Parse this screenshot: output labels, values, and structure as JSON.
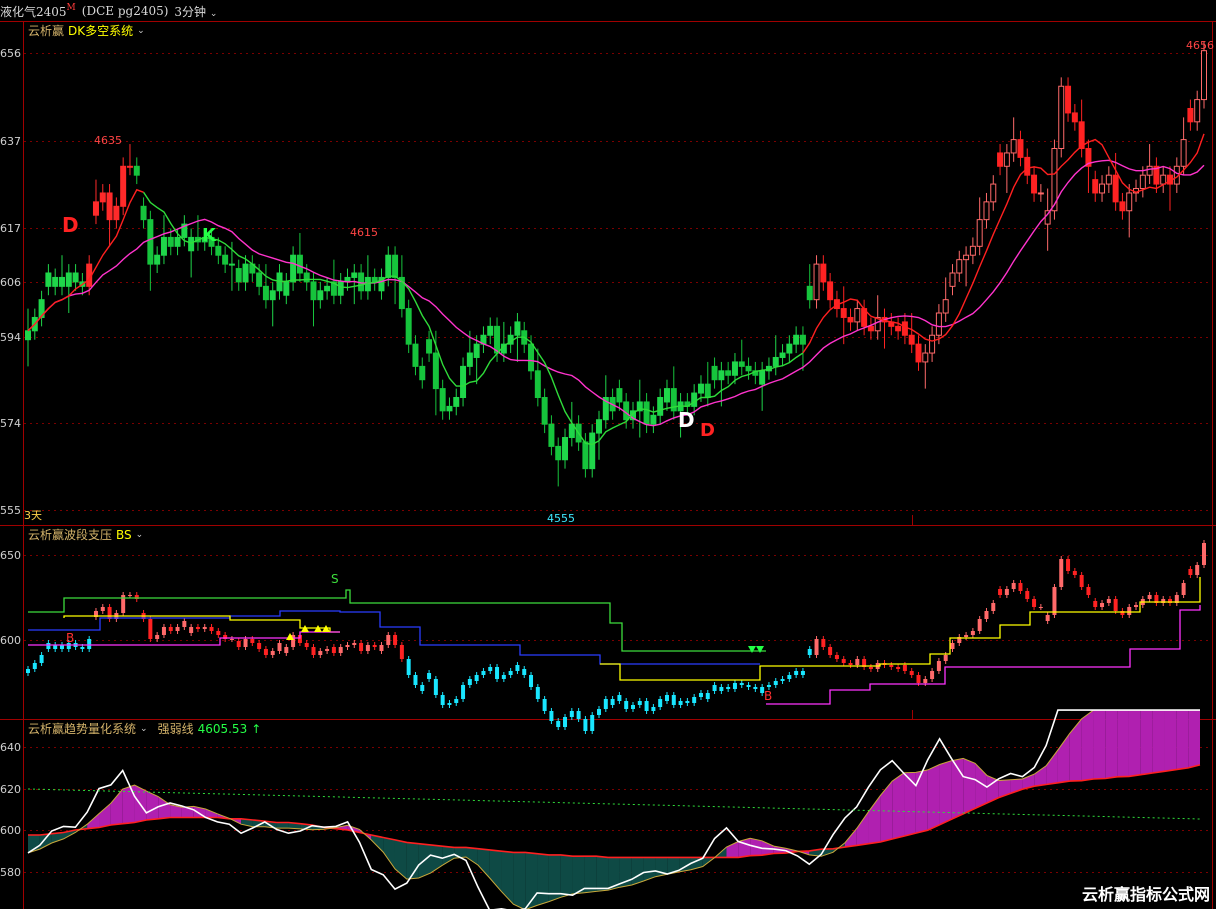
{
  "header": {
    "instrument": "液化气2405",
    "flag": "M",
    "code": "(DCE pg2405)",
    "period": "3分钟"
  },
  "panel1": {
    "title_prefix": "云析赢",
    "title_name": "DK多空系统",
    "y_ticks": [
      "656",
      "637",
      "617",
      "606",
      "594",
      "574",
      "555"
    ],
    "period_label": "3天",
    "labels": {
      "high_left": "4635",
      "mid_high": "4615",
      "low": "4555",
      "high_right": "4656",
      "d1": "D",
      "k1": "K",
      "d2": "D",
      "d3": "D"
    }
  },
  "panel2": {
    "title_prefix": "云析赢波段支压",
    "title_name": "BS",
    "y_ticks": [
      "650",
      "600"
    ],
    "labels": {
      "s": "S",
      "b1": "B",
      "b2": "B"
    }
  },
  "panel3": {
    "title": "云析赢趋势量化系统",
    "strength_label": "强弱线",
    "strength_value": "4605.53",
    "strength_arrow": "↑",
    "y_ticks": [
      "640",
      "620",
      "600",
      "580"
    ]
  },
  "watermark": "云析赢指标公式网",
  "colors": {
    "up": "#ff2a2a",
    "down": "#23e54a",
    "ma_red": "#ff2020",
    "ma_magenta": "#ff33cc",
    "ma_green": "#2fdc3a",
    "bs_green": "#3cdc3c",
    "bs_blue": "#2a3cff",
    "bs_yellow": "#ffff00",
    "bs_magenta": "#ff33ff",
    "bs_cyan": "#19e6ff",
    "fill_magenta": "#b020b0",
    "fill_teal": "#0e4a45",
    "white_line": "#ffffff",
    "grid": "#7a0000"
  },
  "chart_data": {
    "type": "candlestick",
    "symbol": "pg2405",
    "period": "3分钟",
    "price_range": [
      4550,
      4660
    ],
    "key_prices": {
      "high_left": 4635,
      "mid_high": 4615,
      "low": 4555,
      "high_right": 4656
    },
    "closes": [
      4593,
      4596,
      4600,
      4603,
      4605,
      4603,
      4606,
      4604,
      4603,
      4608,
      4622,
      4624,
      4618,
      4621,
      4630,
      4630,
      4628,
      4618,
      4608,
      4610,
      4614,
      4612,
      4614,
      4617,
      4614,
      4613,
      4614,
      4612,
      4610,
      4608,
      4608,
      4604,
      4608,
      4606,
      4603,
      4600,
      4602,
      4606,
      4604,
      4610,
      4606,
      4604,
      4600,
      4602,
      4603,
      4601,
      4604,
      4605,
      4606,
      4602,
      4605,
      4604,
      4605,
      4610,
      4605,
      4598,
      4590,
      4585,
      4582,
      4588,
      4580,
      4575,
      4576,
      4578,
      4585,
      4588,
      4590,
      4592,
      4594,
      4588,
      4590,
      4592,
      4595,
      4590,
      4584,
      4578,
      4572,
      4567,
      4564,
      4569,
      4572,
      4568,
      4562,
      4570,
      4573,
      4578,
      4575,
      4577,
      4573,
      4575,
      4577,
      4572,
      4574,
      4578,
      4580,
      4575,
      4577,
      4576,
      4579,
      4581,
      4578,
      4582,
      4584,
      4583,
      4586,
      4585,
      4584,
      4583,
      4584,
      4585,
      4587,
      4588,
      4590,
      4592,
      4590,
      4600,
      4608,
      4604,
      4600,
      4598,
      4596,
      4595,
      4598,
      4594,
      4593,
      4596,
      4595,
      4594,
      4593,
      4592,
      4590,
      4586,
      4588,
      4592,
      4597,
      4600,
      4606,
      4609,
      4610,
      4612,
      4618,
      4622,
      4626,
      4630,
      4633,
      4636,
      4632,
      4628,
      4624,
      4624,
      4620,
      4634,
      4648,
      4642,
      4640,
      4634,
      4630,
      4624,
      4626,
      4628,
      4622,
      4620,
      4624,
      4625,
      4628,
      4630,
      4626,
      4628,
      4626,
      4630,
      4636,
      4640,
      4645,
      4656
    ],
    "trend_fast": [
      4600,
      4600,
      4601,
      4602,
      4604,
      4605,
      4606,
      4608,
      4609,
      4610,
      4612,
      4613,
      4614,
      4614,
      4614,
      4614,
      4614,
      4613,
      4613,
      4612,
      4611,
      4610,
      4610,
      4609,
      4608,
      4606,
      4605,
      4604,
      4602,
      4600,
      4598,
      4596,
      4594,
      4593,
      4592,
      4591,
      4590,
      4590,
      4589,
      4588,
      4587,
      4586,
      4586,
      4585,
      4584,
      4584,
      4583,
      4583,
      4583,
      4582,
      4582,
      4582,
      4582,
      4582,
      4582,
      4582,
      4582,
      4582,
      4582,
      4582,
      4582,
      4583,
      4583,
      4584,
      4584,
      4585,
      4585,
      4586,
      4586,
      4587,
      4588,
      4589,
      4590,
      4592,
      4594,
      4596,
      4598,
      4602,
      4606,
      4610,
      4614,
      4618,
      4622,
      4625,
      4628,
      4630,
      4631,
      4632,
      4633,
      4633,
      4634,
      4634,
      4635,
      4635,
      4636,
      4637,
      4638,
      4639,
      4640,
      4642
    ]
  }
}
